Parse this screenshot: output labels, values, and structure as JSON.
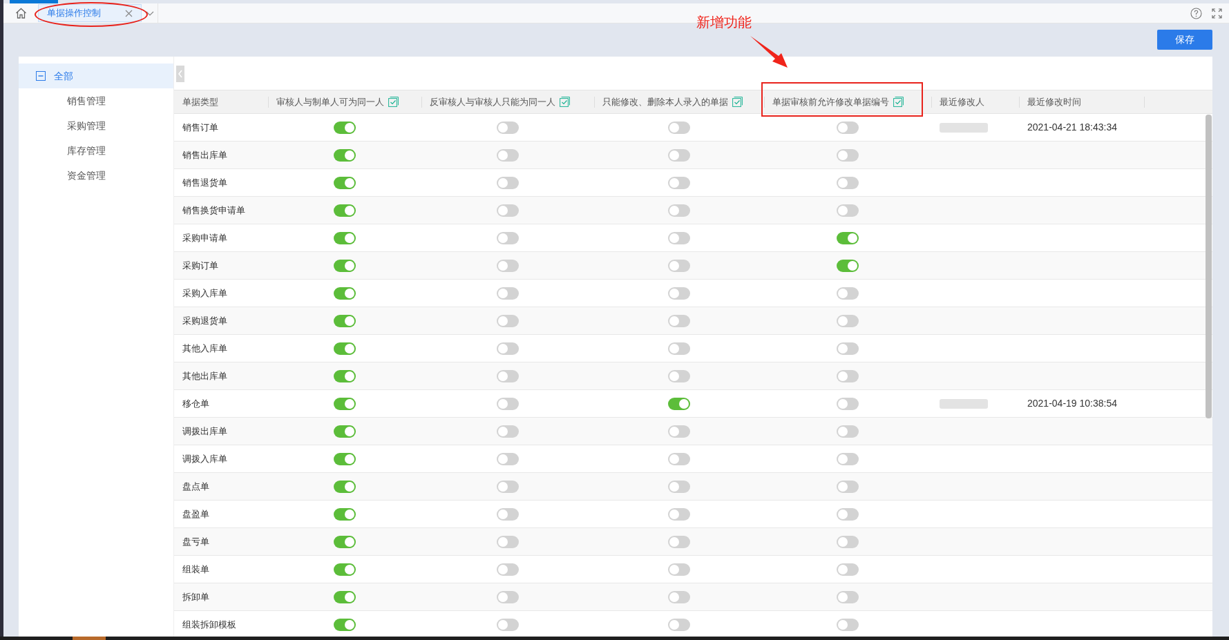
{
  "tab_bar": {
    "tabs": [
      {
        "label": "单据操作控制",
        "selected": true,
        "circled": true
      }
    ]
  },
  "annotation": {
    "label": "新增功能"
  },
  "save_button": {
    "label": "保存"
  },
  "sidebar": {
    "root": {
      "label": "全部",
      "expanded": true,
      "selected": true,
      "children": [
        {
          "label": "销售管理"
        },
        {
          "label": "采购管理"
        },
        {
          "label": "库存管理"
        },
        {
          "label": "资金管理"
        }
      ]
    }
  },
  "table": {
    "columns": [
      {
        "label": "单据类型",
        "kind": "text",
        "boxed": false
      },
      {
        "label": "审核人与制单人可为同一人",
        "kind": "toggle",
        "boxed": false
      },
      {
        "label": "反审核人与审核人只能为同一人",
        "kind": "toggle",
        "boxed": false
      },
      {
        "label": "只能修改、删除本人录入的单据",
        "kind": "toggle",
        "boxed": false
      },
      {
        "label": "单据审核前允许修改单据编号",
        "kind": "toggle",
        "boxed": true
      },
      {
        "label": "最近修改人",
        "kind": "text",
        "boxed": false
      },
      {
        "label": "最近修改时间",
        "kind": "text",
        "boxed": false
      }
    ],
    "rows": [
      {
        "type": "销售订单",
        "switches": [
          {
            "on": true
          },
          {
            "on": false
          },
          {
            "on": false
          },
          {
            "on": false
          }
        ],
        "modifier_redacted": true,
        "modified_time": "2021-04-21 18:43:34"
      },
      {
        "type": "销售出库单",
        "switches": [
          {
            "on": true
          },
          {
            "on": false
          },
          {
            "on": false
          },
          {
            "on": false
          }
        ],
        "modifier_redacted": false
      },
      {
        "type": "销售退货单",
        "switches": [
          {
            "on": true
          },
          {
            "on": false
          },
          {
            "on": false
          },
          {
            "on": false
          }
        ],
        "modifier_redacted": false
      },
      {
        "type": "销售换货申请单",
        "switches": [
          {
            "on": true
          },
          {
            "on": false
          },
          {
            "on": false
          },
          {
            "on": false
          }
        ],
        "modifier_redacted": false
      },
      {
        "type": "采购申请单",
        "switches": [
          {
            "on": true
          },
          {
            "on": false
          },
          {
            "on": false
          },
          {
            "on": true
          }
        ],
        "modifier_redacted": false
      },
      {
        "type": "采购订单",
        "switches": [
          {
            "on": true
          },
          {
            "on": false
          },
          {
            "on": false
          },
          {
            "on": true
          }
        ],
        "modifier_redacted": false
      },
      {
        "type": "采购入库单",
        "switches": [
          {
            "on": true
          },
          {
            "on": false
          },
          {
            "on": false
          },
          {
            "on": false
          }
        ],
        "modifier_redacted": false
      },
      {
        "type": "采购退货单",
        "switches": [
          {
            "on": true
          },
          {
            "on": false
          },
          {
            "on": false
          },
          {
            "on": false
          }
        ],
        "modifier_redacted": false
      },
      {
        "type": "其他入库单",
        "switches": [
          {
            "on": true
          },
          {
            "on": false
          },
          {
            "on": false
          },
          {
            "on": false
          }
        ],
        "modifier_redacted": false
      },
      {
        "type": "其他出库单",
        "switches": [
          {
            "on": true
          },
          {
            "on": false
          },
          {
            "on": false
          },
          {
            "on": false
          }
        ],
        "modifier_redacted": false
      },
      {
        "type": "移仓单",
        "switches": [
          {
            "on": true
          },
          {
            "on": false
          },
          {
            "on": true
          },
          {
            "on": false
          }
        ],
        "modifier_redacted": true,
        "modified_time": "2021-04-19 10:38:54"
      },
      {
        "type": "调拨出库单",
        "switches": [
          {
            "on": true
          },
          {
            "on": false
          },
          {
            "on": false
          },
          {
            "on": false
          }
        ],
        "modifier_redacted": false
      },
      {
        "type": "调拨入库单",
        "switches": [
          {
            "on": true
          },
          {
            "on": false
          },
          {
            "on": false
          },
          {
            "on": false
          }
        ],
        "modifier_redacted": false
      },
      {
        "type": "盘点单",
        "switches": [
          {
            "on": true
          },
          {
            "on": false
          },
          {
            "on": false
          },
          {
            "on": false
          }
        ],
        "modifier_redacted": false
      },
      {
        "type": "盘盈单",
        "switches": [
          {
            "on": true
          },
          {
            "on": false
          },
          {
            "on": false
          },
          {
            "on": false
          }
        ],
        "modifier_redacted": false
      },
      {
        "type": "盘亏单",
        "switches": [
          {
            "on": true
          },
          {
            "on": false
          },
          {
            "on": false
          },
          {
            "on": false
          }
        ],
        "modifier_redacted": false
      },
      {
        "type": "组装单",
        "switches": [
          {
            "on": true
          },
          {
            "on": false
          },
          {
            "on": false
          },
          {
            "on": false
          }
        ],
        "modifier_redacted": false
      },
      {
        "type": "拆卸单",
        "switches": [
          {
            "on": true
          },
          {
            "on": false
          },
          {
            "on": false
          },
          {
            "on": false
          }
        ],
        "modifier_redacted": false
      },
      {
        "type": "组装拆卸模板",
        "switches": [
          {
            "on": true
          },
          {
            "on": false
          },
          {
            "on": false
          },
          {
            "on": false
          }
        ],
        "modifier_redacted": false
      }
    ]
  }
}
